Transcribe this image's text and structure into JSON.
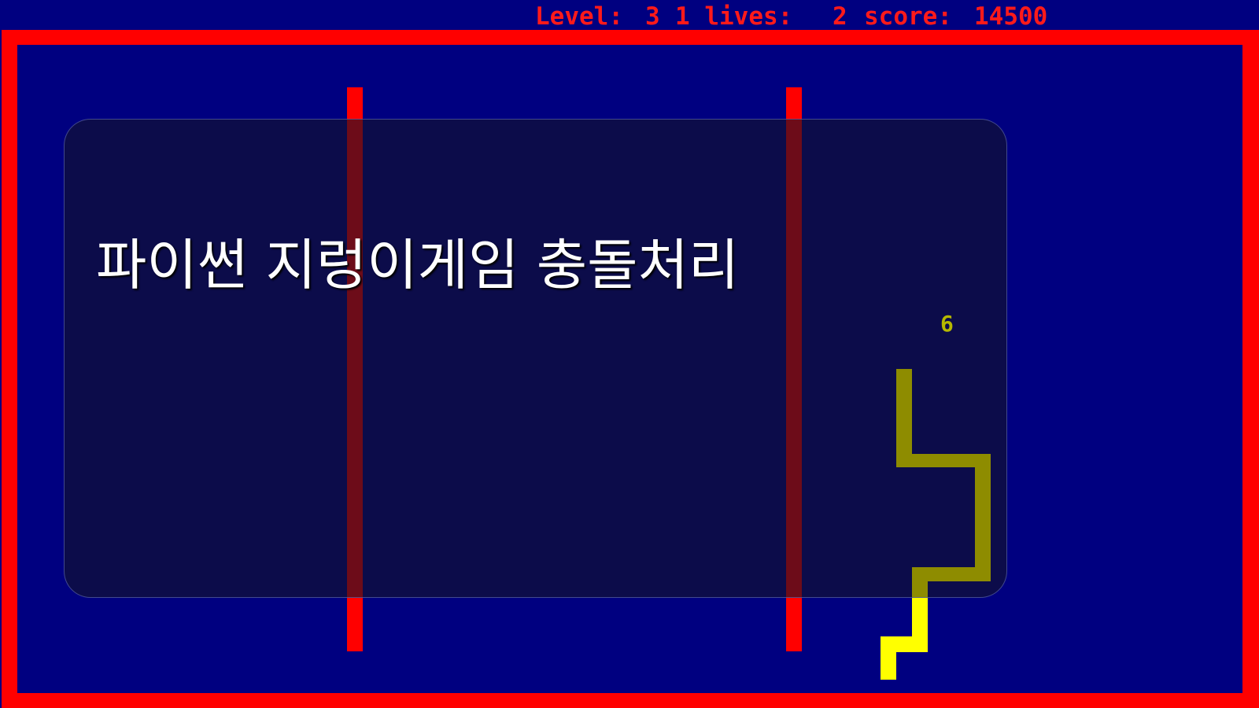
{
  "hud": {
    "level_label": "Level:",
    "level_value": "3",
    "lives_label": "1 lives:",
    "lives_value": "2",
    "score_label": "score:",
    "score_value": "14500"
  },
  "overlay": {
    "caption": "파이썬 지렁이게임 충돌처리"
  },
  "game": {
    "counter": "6"
  },
  "colors": {
    "background": "#000080",
    "border": "#ff0000",
    "hud_text": "#ff1a1a",
    "snake_body": "#8e8c00",
    "snake_head": "#ffff00",
    "counter_text": "#b5b800"
  }
}
